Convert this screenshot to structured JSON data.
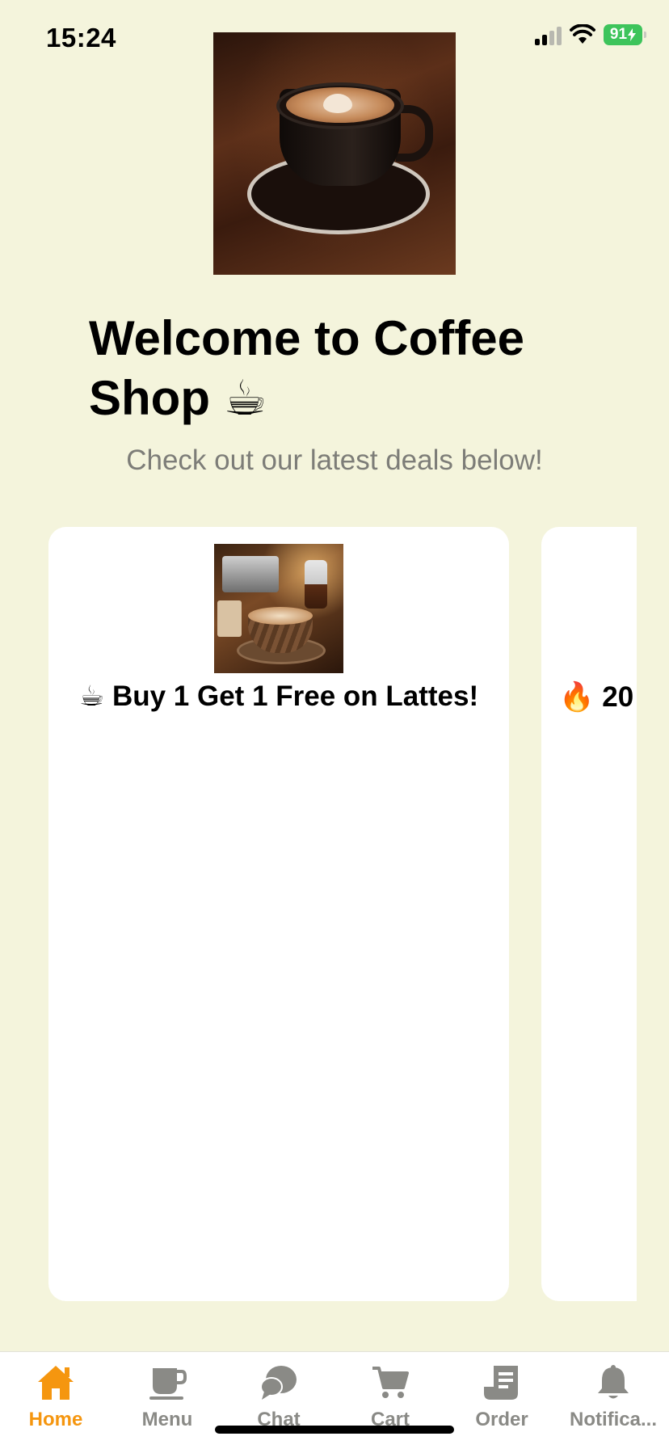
{
  "status_bar": {
    "time": "15:24",
    "battery": "91"
  },
  "header": {
    "title": "Welcome to Coffee Shop ☕",
    "subtitle": "Check out our latest deals below!"
  },
  "deals": [
    {
      "title": "☕ Buy 1 Get 1 Free on Lattes!"
    },
    {
      "title": "🔥 20"
    }
  ],
  "tab_bar": {
    "active_color": "#f5960f",
    "inactive_color": "#8a8a86",
    "tabs": [
      {
        "label": "Home",
        "icon": "home-icon"
      },
      {
        "label": "Menu",
        "icon": "cup-icon"
      },
      {
        "label": "Chat",
        "icon": "chat-icon"
      },
      {
        "label": "Cart",
        "icon": "cart-icon"
      },
      {
        "label": "Order",
        "icon": "receipt-icon"
      },
      {
        "label": "Notifica...",
        "icon": "bell-icon"
      }
    ]
  }
}
